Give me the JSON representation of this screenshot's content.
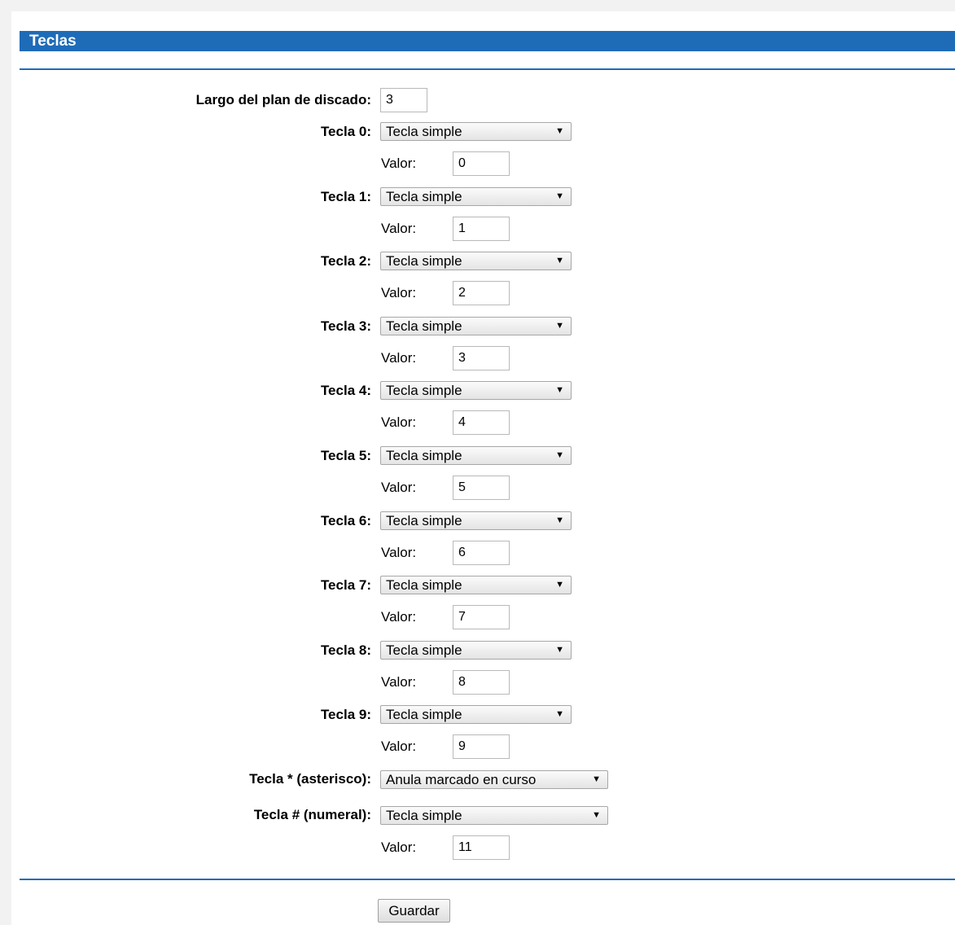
{
  "section": {
    "title": "Teclas"
  },
  "dial_plan": {
    "label": "Largo del plan de discado:",
    "value": "3"
  },
  "valor_label": "Valor:",
  "keys": [
    {
      "label": "Tecla 0:",
      "type": "Tecla simple",
      "value": "0"
    },
    {
      "label": "Tecla 1:",
      "type": "Tecla simple",
      "value": "1"
    },
    {
      "label": "Tecla 2:",
      "type": "Tecla simple",
      "value": "2"
    },
    {
      "label": "Tecla 3:",
      "type": "Tecla simple",
      "value": "3"
    },
    {
      "label": "Tecla 4:",
      "type": "Tecla simple",
      "value": "4"
    },
    {
      "label": "Tecla 5:",
      "type": "Tecla simple",
      "value": "5"
    },
    {
      "label": "Tecla 6:",
      "type": "Tecla simple",
      "value": "6"
    },
    {
      "label": "Tecla 7:",
      "type": "Tecla simple",
      "value": "7"
    },
    {
      "label": "Tecla 8:",
      "type": "Tecla simple",
      "value": "8"
    },
    {
      "label": "Tecla 9:",
      "type": "Tecla simple",
      "value": "9"
    }
  ],
  "asterisk": {
    "label": "Tecla * (asterisco):",
    "type": "Anula marcado en curso"
  },
  "hash": {
    "label": "Tecla # (numeral):",
    "type": "Tecla simple",
    "value": "11"
  },
  "actions": {
    "save_label": "Guardar"
  },
  "icons": {
    "dropdown": "chevron-down-icon"
  },
  "colors": {
    "header_bg": "#1e6cb8",
    "header_text": "#ffffff"
  }
}
